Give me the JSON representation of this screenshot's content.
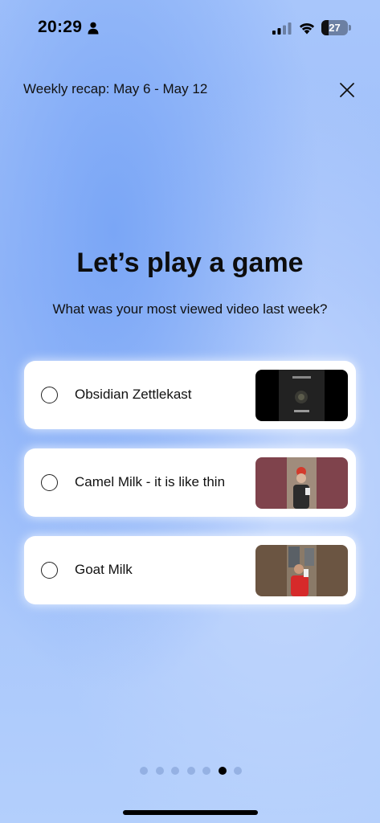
{
  "status_bar": {
    "time": "20:29",
    "battery": "27",
    "battery_level": 0.27
  },
  "header": {
    "title": "Weekly recap: May 6 - May 12",
    "close_icon": "close-icon"
  },
  "game": {
    "heading": "Let’s play a game",
    "question": "What was your most viewed video last week?"
  },
  "options": [
    {
      "label": "Obsidian Zettlekast",
      "thumb_background": "#000000",
      "thumb_inner": "#222222"
    },
    {
      "label": "Camel Milk - it is like thin",
      "thumb_background": "#7f434c",
      "thumb_inner": "#a08c7c"
    },
    {
      "label": "Goat Milk",
      "thumb_background": "#6b5542",
      "thumb_inner": "#8a7a68"
    }
  ],
  "pagination": {
    "count": 7,
    "active_index": 5
  },
  "colors": {
    "accent": "#000000",
    "card": "#ffffff",
    "background": "#a8c6fb"
  }
}
